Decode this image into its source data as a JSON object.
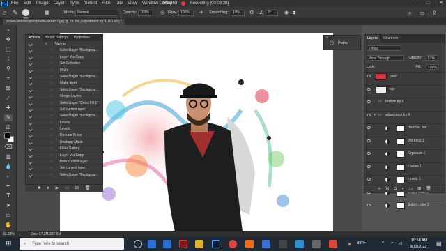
{
  "menubar": {
    "app_icon": "Ps",
    "items": [
      "File",
      "Edit",
      "Image",
      "Layer",
      "Type",
      "Select",
      "Filter",
      "3D",
      "View",
      "Window",
      "Help"
    ],
    "resolution": "1366x768",
    "recording_label": "Recording [00:03:38]"
  },
  "options_bar": {
    "brush_size": "350",
    "mode_label": "Mode:",
    "mode_value": "Normal",
    "opacity_label": "Opacity:",
    "opacity_value": "100%",
    "flow_label": "Flow:",
    "flow_value": "100%",
    "smoothing_label": "Smoothing:",
    "smoothing_value": "10%",
    "angle": "0°"
  },
  "document_tab": "pexels-andrea-piacquadio-845457.jpg @ 33.3% (adjustment try it, RGB/8) *",
  "actions_panel": {
    "tabs": [
      "Actions",
      "Brush Settings",
      "Properties"
    ],
    "rows": [
      {
        "label": "Play me",
        "set": true
      },
      {
        "label": "Select layer \"Backgrou..."
      },
      {
        "label": "Layer Via Copy"
      },
      {
        "label": "Set Selection"
      },
      {
        "label": "Make"
      },
      {
        "label": "Select layer \"Backgrou..."
      },
      {
        "label": "Make layer"
      },
      {
        "label": "Select layer \"Backgrou..."
      },
      {
        "label": "Merge Layers"
      },
      {
        "label": "Select layer \"Color Fill 1\""
      },
      {
        "label": "Set current layer"
      },
      {
        "label": "Select layer \"Backgrou..."
      },
      {
        "label": "Levels"
      },
      {
        "label": "Levels"
      },
      {
        "label": "Reduce Noise"
      },
      {
        "label": "Unsharp Mask"
      },
      {
        "label": "Filter Gallery"
      },
      {
        "label": "Layer Via Copy"
      },
      {
        "label": "Hide current layer"
      },
      {
        "label": "Set current layer"
      },
      {
        "label": "Select layer \"Backgrou..."
      }
    ]
  },
  "paths_panel": {
    "label": "Paths"
  },
  "layers_panel": {
    "tabs": [
      "Layers",
      "Channels"
    ],
    "kind_label": "Kind",
    "blend_mode": "Pass Through",
    "opacity_label": "Opacity:",
    "opacity_value": "51%",
    "lock_label": "Lock:",
    "fill_label": "Fill:",
    "fill_value": "100%",
    "layers": [
      {
        "name": "paint",
        "type": "pixel",
        "thumb": "#d9363e"
      },
      {
        "name": "top",
        "type": "pixel",
        "thumb": "#f0f0f0"
      },
      {
        "name": "texture try it",
        "type": "group"
      },
      {
        "name": "adjustment try it",
        "type": "group"
      },
      {
        "name": "Hue/Sa...ion 1",
        "type": "adj"
      },
      {
        "name": "Vibrance 1",
        "type": "adj"
      },
      {
        "name": "Exposure 1",
        "type": "adj"
      },
      {
        "name": "Curves 1",
        "type": "adj"
      },
      {
        "name": "Levels 1",
        "type": "adj"
      },
      {
        "name": "Bright...rast 1",
        "type": "adj"
      },
      {
        "name": "Select...olor 1",
        "type": "adj"
      }
    ]
  },
  "status_bar": {
    "zoom": "33.33%",
    "doc_info": "Doc: 17.2M/387.6M"
  },
  "taskbar": {
    "search_placeholder": "Type here to search",
    "weather": "88°F",
    "time": "10:58 AM",
    "date": "8/13/2022"
  },
  "colors": {
    "panel_bg": "#3c3c3c",
    "canvas_bg": "#ffffff",
    "accent": "#31a8ff"
  }
}
